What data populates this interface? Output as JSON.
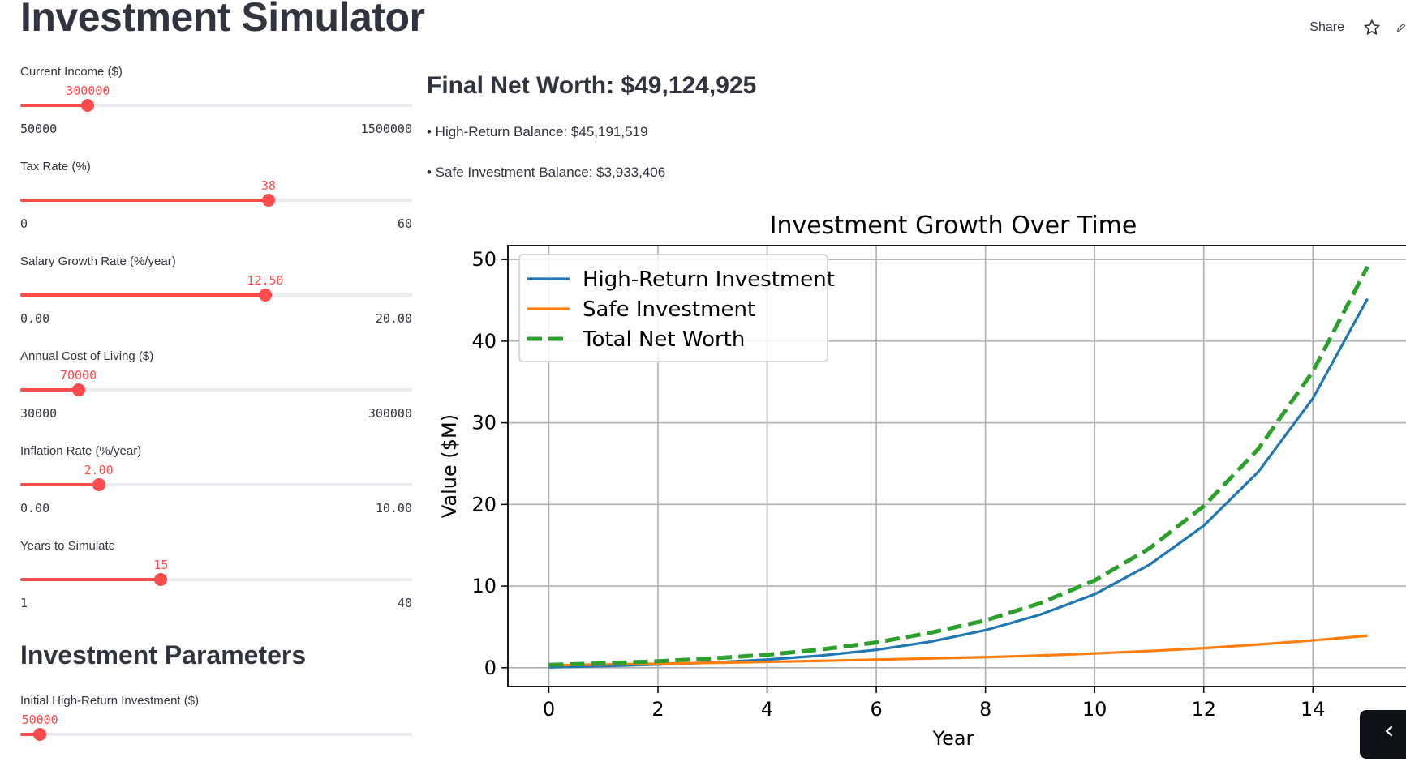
{
  "header": {
    "title": "Investment Simulator",
    "share_label": "Share",
    "star_icon": "star-icon",
    "edit_icon": "pencil-icon"
  },
  "sliders": [
    {
      "label": "Current Income ($)",
      "value": "300000",
      "min": "50000",
      "max": "1500000",
      "fraction": 0.1724
    },
    {
      "label": "Tax Rate (%)",
      "value": "38",
      "min": "0",
      "max": "60",
      "fraction": 0.6333
    },
    {
      "label": "Salary Growth Rate (%/year)",
      "value": "12.50",
      "min": "0.00",
      "max": "20.00",
      "fraction": 0.625
    },
    {
      "label": "Annual Cost of Living ($)",
      "value": "70000",
      "min": "30000",
      "max": "300000",
      "fraction": 0.1481
    },
    {
      "label": "Inflation Rate (%/year)",
      "value": "2.00",
      "min": "0.00",
      "max": "10.00",
      "fraction": 0.2
    },
    {
      "label": "Years to Simulate",
      "value": "15",
      "min": "1",
      "max": "40",
      "fraction": 0.359
    }
  ],
  "investment_params": {
    "title": "Investment Parameters",
    "sliders": [
      {
        "label": "Initial High-Return Investment ($)",
        "value": "50000",
        "fraction": 0.05
      }
    ]
  },
  "results": {
    "final_net_worth": "Final Net Worth: $49,124,925",
    "high_return_balance": "• High-Return Balance: $45,191,519",
    "safe_balance": "• Safe Investment Balance: $3,933,406"
  },
  "chart_data": {
    "type": "line",
    "title": "Investment Growth Over Time",
    "xlabel": "Year",
    "ylabel": "Value ($M)",
    "xlim": [
      -0.75,
      15.75
    ],
    "ylim": [
      -2.3,
      51.7
    ],
    "xticks": [
      "0",
      "2",
      "4",
      "6",
      "8",
      "10",
      "12",
      "14"
    ],
    "yticks": [
      "0",
      "10",
      "20",
      "30",
      "40",
      "50"
    ],
    "grid": true,
    "legend_position": "top-left",
    "x": [
      0,
      1,
      2,
      3,
      4,
      5,
      6,
      7,
      8,
      9,
      10,
      11,
      12,
      13,
      14,
      15
    ],
    "series": [
      {
        "name": "High-Return Investment",
        "color": "#1f77b4",
        "style": "solid",
        "values": [
          0.05,
          0.2,
          0.4,
          0.65,
          1.0,
          1.5,
          2.2,
          3.2,
          4.6,
          6.5,
          9.0,
          12.6,
          17.4,
          24.0,
          33.0,
          45.19
        ]
      },
      {
        "name": "Safe Investment",
        "color": "#ff7f0e",
        "style": "solid",
        "values": [
          0.3,
          0.4,
          0.5,
          0.6,
          0.72,
          0.85,
          1.0,
          1.15,
          1.3,
          1.5,
          1.75,
          2.05,
          2.4,
          2.85,
          3.35,
          3.93
        ]
      },
      {
        "name": "Total Net Worth",
        "color": "#2ca02c",
        "style": "dashed",
        "values": [
          0.35,
          0.55,
          0.8,
          1.15,
          1.6,
          2.25,
          3.1,
          4.3,
          5.8,
          7.9,
          10.7,
          14.6,
          19.8,
          26.8,
          36.3,
          49.12
        ]
      }
    ]
  },
  "collapse_icon": "chevron-left-icon"
}
